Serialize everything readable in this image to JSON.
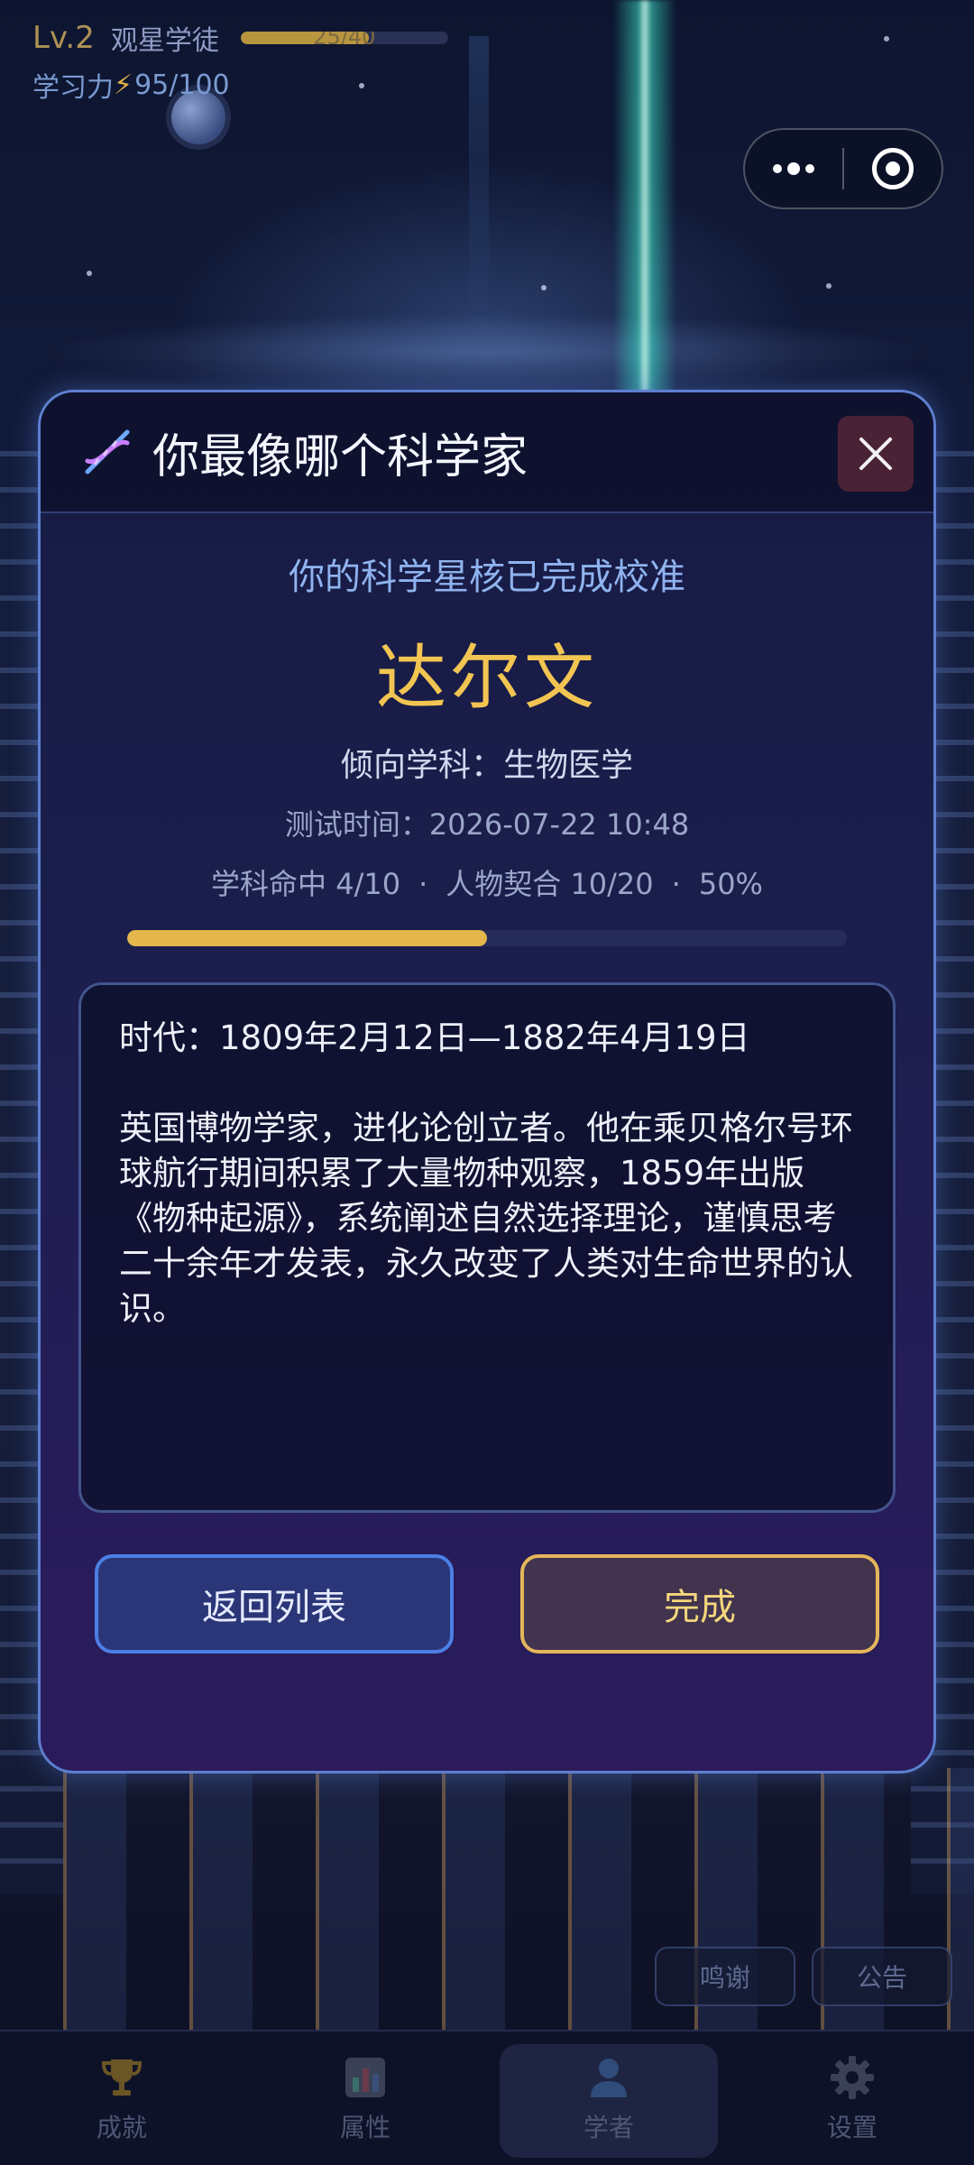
{
  "status": {
    "level": "Lv.2",
    "rank": "观星学徒",
    "xp_text": "25/40",
    "xp_fraction": 0.62,
    "power_label": "学习力",
    "power_value": "95/100"
  },
  "capsule": {
    "more_icon": "more-dots-icon",
    "close_icon": "target-close-icon"
  },
  "dialog": {
    "title": "你最像哪个科学家",
    "title_icon": "dna-icon",
    "calibration_text": "你的科学星核已完成校准",
    "scientist_name": "达尔文",
    "subject_line": "倾向学科：生物医学",
    "test_time": "测试时间：2026-07-22 10:48",
    "stats": {
      "subject_hit": "学科命中 4/10",
      "person_match": "人物契合 10/20",
      "percent": "50%"
    },
    "progress_fraction": 0.5,
    "era": "时代：1809年2月12日—1882年4月19日",
    "bio": "英国博物学家，进化论创立者。他在乘贝格尔号环球航行期间积累了大量物种观察，1859年出版《物种起源》，系统阐述自然选择理论，谨慎思考二十余年才发表，永久改变了人类对生命世界的认识。",
    "back_button": "返回列表",
    "done_button": "完成"
  },
  "side_buttons": {
    "thanks": "鸣谢",
    "notice": "公告"
  },
  "tabbar": [
    {
      "label": "成就",
      "icon": "trophy-icon"
    },
    {
      "label": "属性",
      "icon": "bar-chart-icon"
    },
    {
      "label": "学者",
      "icon": "person-icon"
    },
    {
      "label": "设置",
      "icon": "gear-icon"
    }
  ],
  "colors": {
    "accent_gold": "#f2c552",
    "accent_blue": "#4d7fe6",
    "dialog_border": "#5d7fcf"
  }
}
